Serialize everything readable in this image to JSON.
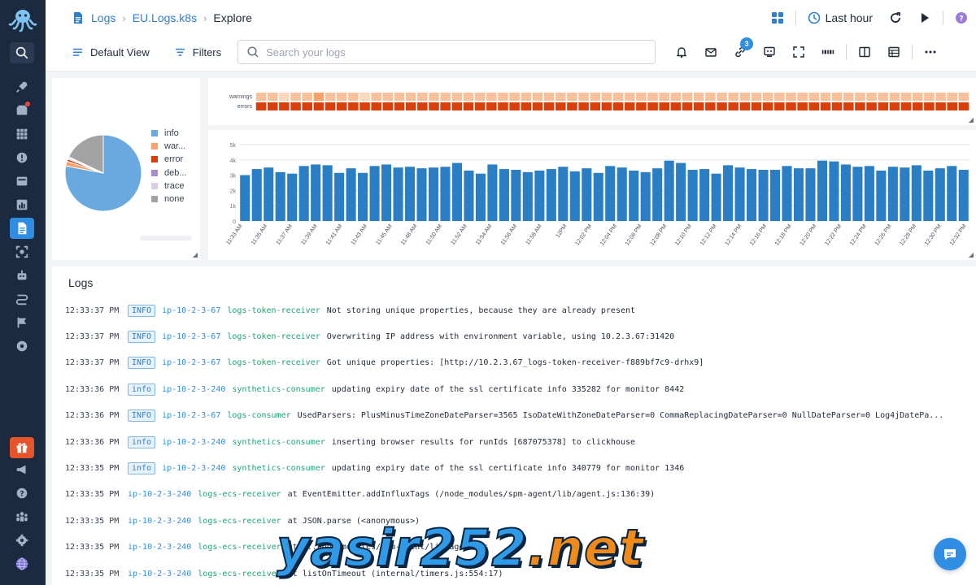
{
  "app": {
    "title": "Logs — Explore"
  },
  "breadcrumbs": [
    {
      "label": "Logs"
    },
    {
      "label": "EU.Logs.k8s"
    },
    {
      "label": "Explore"
    }
  ],
  "header": {
    "time_range": "Last hour"
  },
  "toolbar": {
    "default_view": "Default View",
    "filters": "Filters",
    "search_placeholder": "Search your logs",
    "alerts_badge": "3"
  },
  "colors": {
    "brand": "#2f8ee4",
    "info": "#6aa9df",
    "warning": "#f6a26a",
    "error": "#d93f0b",
    "debug": "#a78bcc",
    "trace": "#d9cdea",
    "none": "#a3a3a3"
  },
  "chart_data": [
    {
      "type": "pie",
      "title": "",
      "categories": [
        "info",
        "war...",
        "error",
        "deb...",
        "trace",
        "none"
      ],
      "values": [
        78,
        2,
        1,
        0.5,
        0.5,
        18
      ]
    },
    {
      "type": "heatmap",
      "title": "",
      "rows": [
        "warnings",
        "errors"
      ],
      "warnings": [
        2,
        2,
        1,
        2,
        2,
        3,
        2,
        2,
        2,
        1,
        2,
        2,
        2,
        2,
        2,
        2,
        2,
        2,
        2,
        2,
        2,
        2,
        2,
        2,
        2,
        2,
        2,
        2,
        2,
        2,
        2,
        2,
        2,
        2,
        2,
        2,
        2,
        2,
        2,
        2,
        2,
        2,
        2,
        2,
        2,
        2,
        2,
        2,
        2,
        2,
        2,
        2,
        2,
        2,
        2,
        2,
        2,
        2,
        2,
        2,
        2,
        2
      ],
      "errors": [
        3,
        3,
        3,
        3,
        3,
        3,
        3,
        3,
        3,
        3,
        3,
        3,
        3,
        3,
        3,
        3,
        3,
        3,
        3,
        3,
        3,
        3,
        3,
        3,
        3,
        3,
        3,
        3,
        3,
        3,
        3,
        3,
        3,
        3,
        3,
        3,
        3,
        3,
        3,
        3,
        3,
        3,
        3,
        3,
        3,
        3,
        3,
        3,
        3,
        3,
        3,
        3,
        3,
        3,
        3,
        3,
        3,
        3,
        3,
        3,
        3,
        3
      ]
    },
    {
      "type": "bar",
      "title": "",
      "ylim": [
        0,
        5000
      ],
      "yticks": [
        "0",
        "1k",
        "2k",
        "3k",
        "4k",
        "5k"
      ],
      "xticks": [
        "11:33 AM",
        "11:35 AM",
        "11:37 AM",
        "11:39 AM",
        "11:41 AM",
        "11:43 AM",
        "11:45 AM",
        "11:48 AM",
        "11:50 AM",
        "11:52 AM",
        "11:54 AM",
        "11:56 AM",
        "11:58 AM",
        "12PM",
        "12:02 PM",
        "12:04 PM",
        "12:06 PM",
        "12:08 PM",
        "12:10 PM",
        "12:12 PM",
        "12:14 PM",
        "12:16 PM",
        "12:18 PM",
        "12:20 PM",
        "12:22 PM",
        "12:24 PM",
        "12:26 PM",
        "12:28 PM",
        "12:30 PM",
        "12:32 PM"
      ],
      "values": [
        3000,
        3400,
        3500,
        3200,
        3100,
        3600,
        3700,
        3650,
        3150,
        3450,
        3150,
        3600,
        3700,
        3500,
        3550,
        3450,
        3500,
        3550,
        3800,
        3300,
        3100,
        3700,
        3400,
        3350,
        3200,
        3300,
        3400,
        3550,
        3250,
        3450,
        3150,
        3600,
        3500,
        3300,
        3200,
        3450,
        3950,
        3800,
        3350,
        3400,
        3100,
        3650,
        3500,
        3400,
        3350,
        3350,
        3600,
        3450,
        3450,
        3950,
        3900,
        3700,
        3550,
        3600,
        3300,
        3550,
        3500,
        3650,
        3300,
        3450,
        3600,
        3350
      ]
    }
  ],
  "logs": {
    "title": "Logs",
    "rows": [
      {
        "time": "12:33:37 PM",
        "level": "INFO",
        "host": "ip-10-2-3-67",
        "service": "logs-token-receiver",
        "message": "Not storing unique properties, because they are already present"
      },
      {
        "time": "12:33:37 PM",
        "level": "INFO",
        "host": "ip-10-2-3-67",
        "service": "logs-token-receiver",
        "message": "Overwriting IP address with environment variable, using 10.2.3.67:31420"
      },
      {
        "time": "12:33:37 PM",
        "level": "INFO",
        "host": "ip-10-2-3-67",
        "service": "logs-token-receiver",
        "message": "Got unique properties: [http://10.2.3.67_logs-token-receiver-f889bf7c9-drhx9]"
      },
      {
        "time": "12:33:36 PM",
        "level": "info",
        "host": "ip-10-2-3-240",
        "service": "synthetics-consumer",
        "message": "updating expiry date of the ssl certificate info 335282 for monitor 8442"
      },
      {
        "time": "12:33:36 PM",
        "level": "INFO",
        "host": "ip-10-2-3-67",
        "service": "logs-consumer",
        "message": "UsedParsers: PlusMinusTimeZoneDateParser=3565 IsoDateWithZoneDateParser=0 CommaReplacingDateParser=0 NullDateParser=0 Log4jDatePa..."
      },
      {
        "time": "12:33:36 PM",
        "level": "info",
        "host": "ip-10-2-3-240",
        "service": "synthetics-consumer",
        "message": "inserting browser results for runIds [687075378] to clickhouse"
      },
      {
        "time": "12:33:35 PM",
        "level": "info",
        "host": "ip-10-2-3-240",
        "service": "synthetics-consumer",
        "message": "updating expiry date of the ssl certificate info 340779 for monitor 1346"
      },
      {
        "time": "12:33:35 PM",
        "level": "",
        "host": "ip-10-2-3-240",
        "service": "logs-ecs-receiver",
        "message": "at EventEmitter.addInfluxTags (/node_modules/spm-agent/lib/agent.js:136:39)"
      },
      {
        "time": "12:33:35 PM",
        "level": "",
        "host": "ip-10-2-3-240",
        "service": "logs-ecs-receiver",
        "message": "at JSON.parse (<anonymous>)"
      },
      {
        "time": "12:33:35 PM",
        "level": "",
        "host": "ip-10-2-3-240",
        "service": "logs-ecs-receiver",
        "message": "at ...node_modules/spm-agent/lib/agent.js"
      },
      {
        "time": "12:33:35 PM",
        "level": "",
        "host": "ip-10-2-3-240",
        "service": "logs-ecs-receiver",
        "message": "at listOnTimeout (internal/timers.js:554:17)"
      }
    ]
  },
  "watermark": {
    "text": "yasir252",
    "suffix": ".net"
  }
}
